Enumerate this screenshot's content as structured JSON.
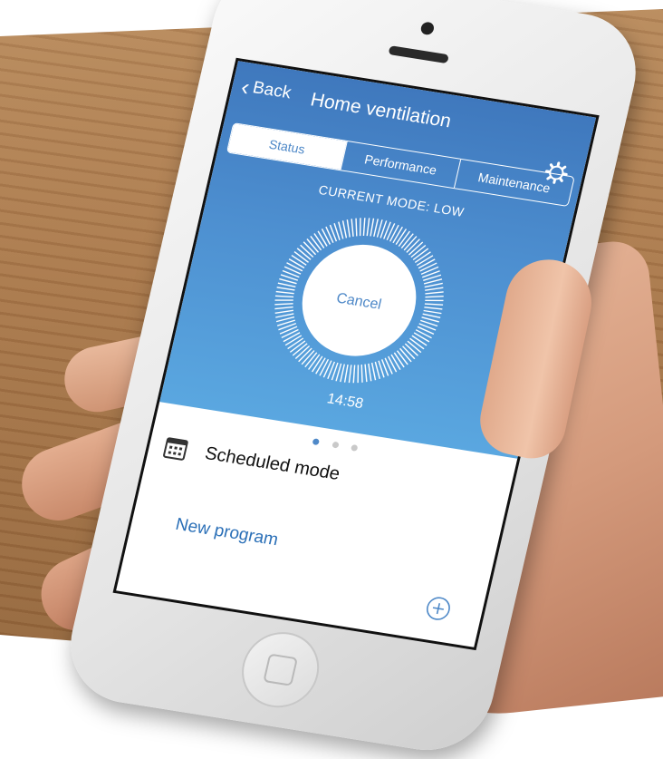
{
  "nav": {
    "back_label": "Back",
    "title": "Home ventilation"
  },
  "tabs": [
    {
      "label": "Status",
      "selected": true
    },
    {
      "label": "Performance",
      "selected": false
    },
    {
      "label": "Maintenance",
      "selected": false
    }
  ],
  "status": {
    "mode_label": "CURRENT MODE: LOW",
    "cancel_label": "Cancel",
    "timer": "14:58"
  },
  "pager": {
    "count": 3,
    "active_index": 0
  },
  "schedule": {
    "label": "Scheduled mode",
    "new_program_label": "New program"
  },
  "icons": [
    "chevron-left-icon",
    "gear-icon",
    "calendar-icon",
    "plus-circle-icon"
  ],
  "colors": {
    "accent": "#4f89c8",
    "link": "#2a6fb7",
    "header_top": "#3f78bd",
    "header_bottom": "#5aa7e0"
  }
}
